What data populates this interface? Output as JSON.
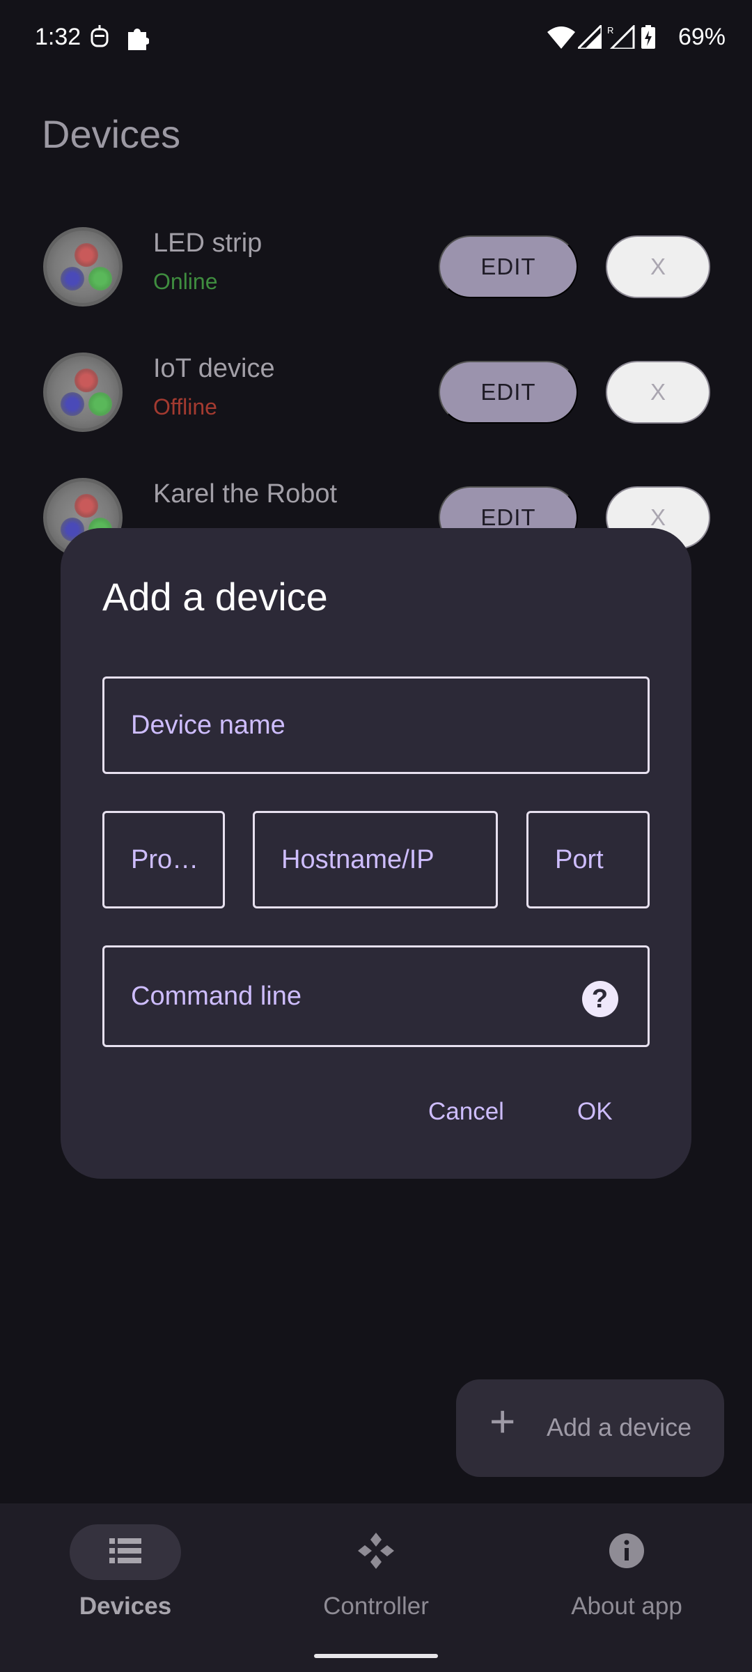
{
  "status_bar": {
    "time": "1:32",
    "battery": "69%",
    "icons": [
      "robot-icon",
      "puzzle-icon",
      "wifi-icon",
      "signal-icon",
      "roaming-signal-icon",
      "battery-charging-icon"
    ]
  },
  "page": {
    "title": "Devices"
  },
  "devices": [
    {
      "name": "LED strip",
      "status": "Online",
      "edit_label": "EDIT",
      "remove_label": "X"
    },
    {
      "name": "IoT device",
      "status": "Offline",
      "edit_label": "EDIT",
      "remove_label": "X"
    },
    {
      "name": "Karel the Robot",
      "status": "",
      "edit_label": "EDIT",
      "remove_label": "X"
    }
  ],
  "dialog": {
    "title": "Add a device",
    "device_name_placeholder": "Device name",
    "protocol_placeholder": "Pro…",
    "hostname_placeholder": "Hostname/IP",
    "port_placeholder": "Port",
    "command_line_placeholder": "Command line",
    "cancel_label": "Cancel",
    "ok_label": "OK"
  },
  "fab": {
    "label": "Add a device"
  },
  "bottom_nav": {
    "items": [
      {
        "label": "Devices",
        "icon": "list-icon",
        "active": true
      },
      {
        "label": "Controller",
        "icon": "controller-icon",
        "active": false
      },
      {
        "label": "About app",
        "icon": "info-icon",
        "active": false
      }
    ]
  },
  "colors": {
    "online": "#3f8d3f",
    "offline": "#a33a30",
    "dialog_accent": "#cebdfe",
    "edit_button": "#9b93ad"
  }
}
